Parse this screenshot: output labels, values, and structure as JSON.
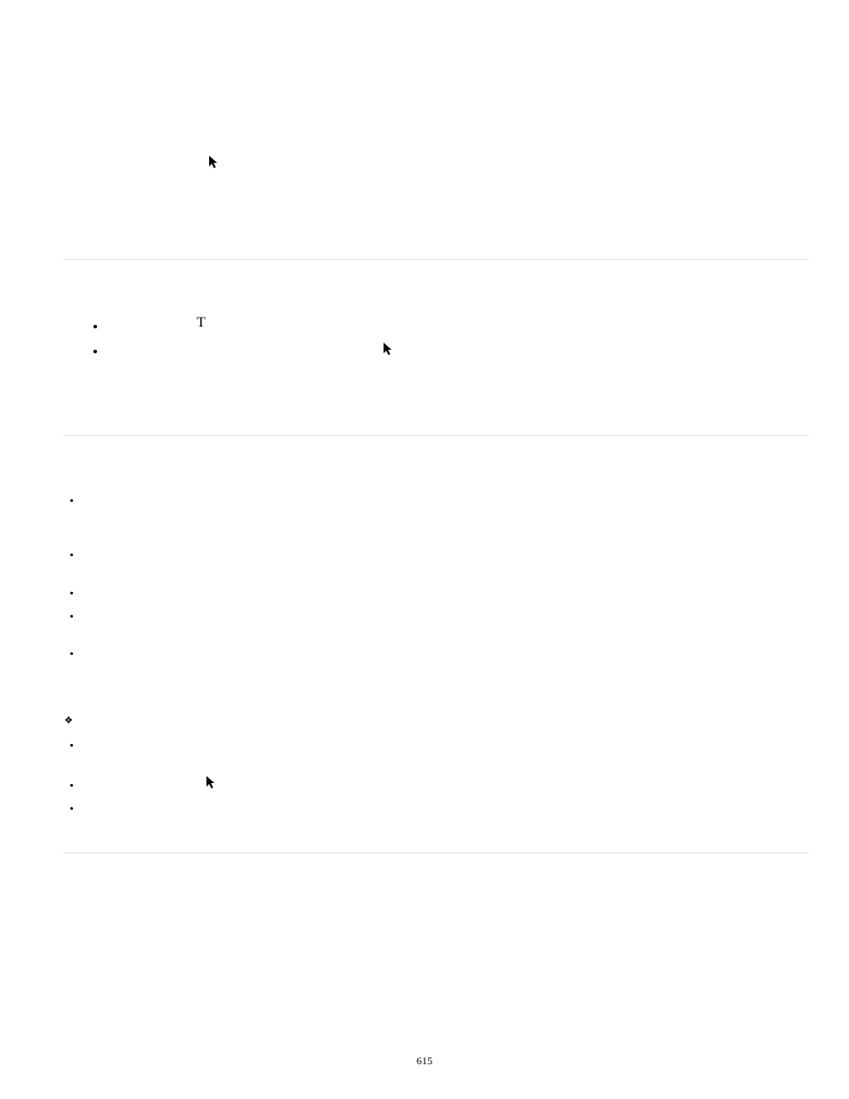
{
  "page": {
    "number": "615"
  },
  "glyphs": {
    "letter_t": "T",
    "diamond": "❖"
  },
  "icons": {
    "cursor_label": "cursor"
  }
}
